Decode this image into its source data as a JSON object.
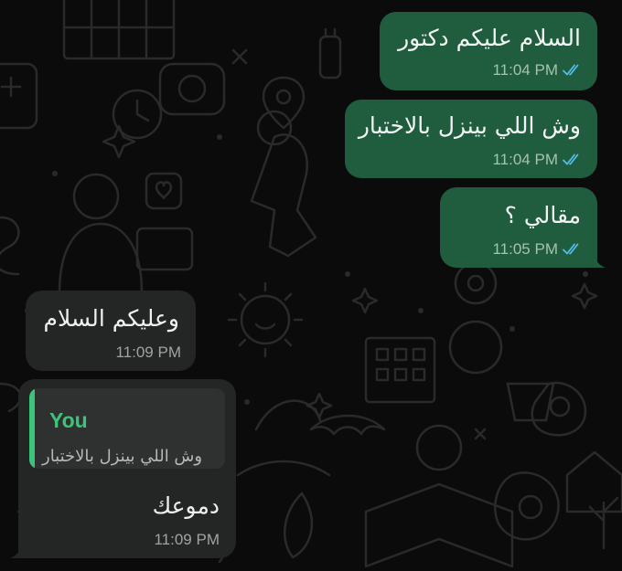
{
  "messages": [
    {
      "direction": "outgoing",
      "text": "السلام عليكم دكتور",
      "time": "11:04 PM",
      "status": "read"
    },
    {
      "direction": "outgoing",
      "text": "وش اللي بينزل بالاختبار",
      "time": "11:04 PM",
      "status": "read"
    },
    {
      "direction": "outgoing",
      "text": "مقالي ؟",
      "time": "11:05 PM",
      "status": "read"
    },
    {
      "direction": "incoming",
      "text": "وعليكم السلام",
      "time": "11:09 PM"
    },
    {
      "direction": "incoming",
      "reply_to": {
        "author": "You",
        "text": "وش اللي بينزل بالاختبار"
      },
      "text": "دموعك",
      "time": "11:09 PM"
    }
  ],
  "colors": {
    "background": "#0b0b0b",
    "outgoing_bubble": "#1f5d3e",
    "incoming_bubble": "#242626",
    "read_ticks": "#53bdeb",
    "reply_accent": "#3cc47a"
  },
  "icons": {
    "read_status": "double-check-icon"
  }
}
